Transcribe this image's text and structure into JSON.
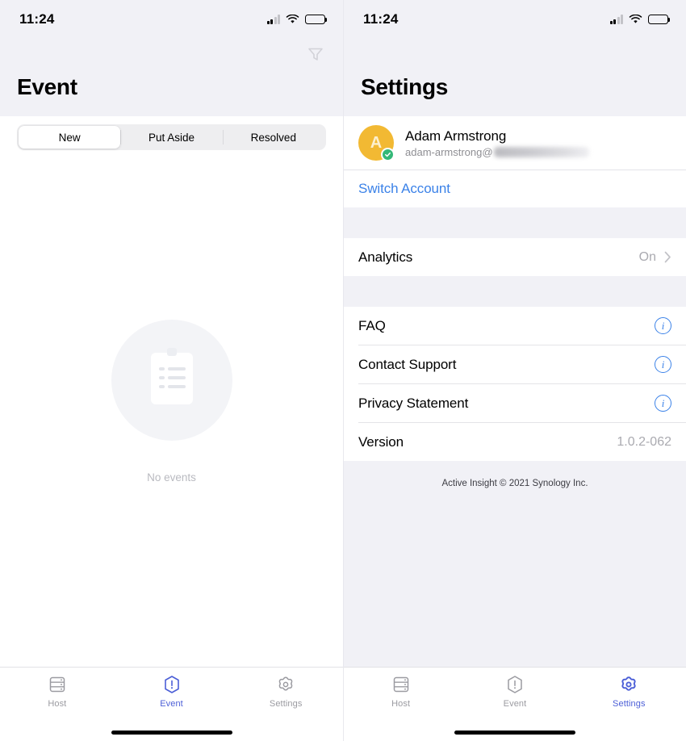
{
  "screens": [
    {
      "id": "event-screen",
      "statusbar": {
        "time": "11:24",
        "cellular_icon": "cellular-bars-icon",
        "wifi_icon": "wifi-icon",
        "battery_icon": "battery-full-icon"
      },
      "header": {
        "title": "Event",
        "filter_icon": "filter-funnel-icon"
      },
      "segmented": {
        "options": [
          "New",
          "Put Aside",
          "Resolved"
        ],
        "selected": "New"
      },
      "empty_state": {
        "illustration_icon": "clipboard-icon",
        "label": "No events"
      },
      "tabbar": {
        "items": [
          {
            "label": "Host",
            "icon": "server-rack-icon",
            "active": false
          },
          {
            "label": "Event",
            "icon": "hexagon-exclamation-icon",
            "active": true
          },
          {
            "label": "Settings",
            "icon": "gear-icon",
            "active": false
          }
        ]
      }
    },
    {
      "id": "settings-screen",
      "statusbar": {
        "time": "11:24",
        "cellular_icon": "cellular-bars-icon",
        "wifi_icon": "wifi-icon",
        "battery_icon": "battery-full-icon"
      },
      "header": {
        "title": "Settings"
      },
      "account": {
        "avatar_initial": "A",
        "avatar_color": "#f2b933",
        "verified_badge_icon": "check-badge-icon",
        "name": "Adam Armstrong",
        "email_visible": "adam-armstrong@",
        "email_redacted": true
      },
      "switch_account": {
        "label": "Switch Account"
      },
      "groups": [
        {
          "rows": [
            {
              "label": "Analytics",
              "value": "On",
              "accessory": "chevron-right-icon"
            }
          ]
        },
        {
          "rows": [
            {
              "label": "FAQ",
              "value": "",
              "accessory": "info-circle-icon"
            },
            {
              "label": "Contact Support",
              "value": "",
              "accessory": "info-circle-icon"
            },
            {
              "label": "Privacy Statement",
              "value": "",
              "accessory": "info-circle-icon"
            },
            {
              "label": "Version",
              "value": "1.0.2-062",
              "accessory": "none"
            }
          ]
        }
      ],
      "copyright": "Active Insight © 2021 Synology Inc.",
      "tabbar": {
        "items": [
          {
            "label": "Host",
            "icon": "server-rack-icon",
            "active": false
          },
          {
            "label": "Event",
            "icon": "hexagon-exclamation-icon",
            "active": false
          },
          {
            "label": "Settings",
            "icon": "gear-icon",
            "active": true
          }
        ]
      }
    }
  ],
  "colors": {
    "accent_blue": "#3b82e8",
    "tab_active": "#4c5fd7",
    "header_bg": "#f1f1f6",
    "avatar_yellow": "#f2b933",
    "badge_green": "#34b878"
  }
}
